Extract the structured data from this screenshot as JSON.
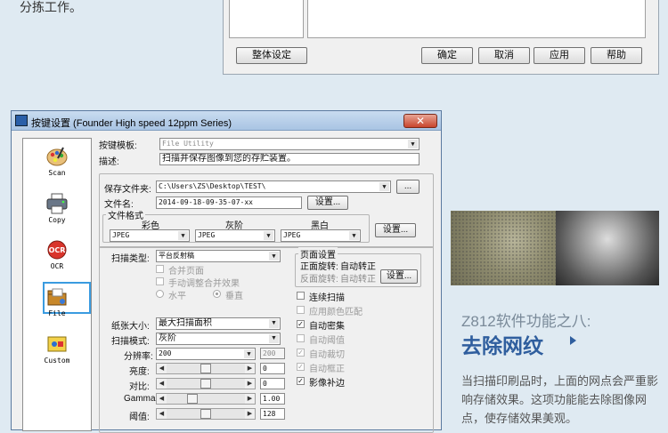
{
  "top_text": "分拣工作。",
  "prev_dialog": {
    "buttons": {
      "global": "整体设定",
      "ok": "确定",
      "cancel": "取消",
      "apply": "应用",
      "help": "帮助"
    }
  },
  "dialog": {
    "title": "按键设置 (Founder High speed 12ppm Series)",
    "close_label": "✕",
    "left_items": [
      {
        "label": "Scan",
        "icon": "paint-palette-icon"
      },
      {
        "label": "Copy",
        "icon": "printer-icon"
      },
      {
        "label": "OCR",
        "icon": "ocr-icon"
      },
      {
        "label": "File",
        "icon": "file-folder-icon"
      },
      {
        "label": "Custom",
        "icon": "custom-tools-icon"
      }
    ],
    "selected_item": "File",
    "template_label": "按键模板:",
    "template_value": "File Utility",
    "desc_label": "描述:",
    "desc_value": "扫描并保存图像到您的存贮装置。",
    "save_folder_label": "保存文件夹:",
    "save_folder_value": "C:\\Users\\ZS\\Desktop\\TEST\\",
    "browse_button": "...",
    "filename_label": "文件名:",
    "filename_value": "2014-09-18-09-35-07-xx",
    "filename_settings_button": "设置...",
    "file_format": {
      "title": "文件格式",
      "color_label": "彩色",
      "gray_label": "灰阶",
      "bw_label": "黑白",
      "color_value": "JPEG",
      "gray_value": "JPEG",
      "bw_value": "JPEG",
      "settings_button": "设置..."
    },
    "scan_type_label": "扫描类型:",
    "scan_type_value": "平台反射稿",
    "merge_pages_label": "合并页面",
    "manual_merge_label": "手动调整合并效果",
    "horizontal_label": "水平",
    "vertical_label": "垂直",
    "page_settings": {
      "title": "页面设置",
      "front_rotate_label": "正面旋转:",
      "front_rotate_value": "自动转正",
      "back_rotate_label": "反面旋转:",
      "back_rotate_value": "自动转正",
      "settings_button": "设置..."
    },
    "checks": [
      {
        "label": "连续扫描",
        "checked": false,
        "enabled": true
      },
      {
        "label": "应用颜色匹配",
        "checked": false,
        "enabled": false
      },
      {
        "label": "自动密集",
        "checked": true,
        "enabled": true
      },
      {
        "label": "自动阈值",
        "checked": false,
        "enabled": false
      },
      {
        "label": "自动裁切",
        "checked": true,
        "enabled": false
      },
      {
        "label": "自动框正",
        "checked": true,
        "enabled": false
      },
      {
        "label": "影像补边",
        "checked": true,
        "enabled": true
      }
    ],
    "paper_size_label": "纸张大小:",
    "paper_size_value": "最大扫描面积",
    "scan_mode_label": "扫描模式:",
    "scan_mode_value": "灰阶",
    "resolution_label": "分辨率:",
    "resolution_value": "200",
    "resolution_value2": "200",
    "brightness_label": "亮度:",
    "brightness_value": "0",
    "contrast_label": "对比:",
    "contrast_value": "0",
    "gamma_label": "Gamma:",
    "gamma_value": "1.00",
    "threshold_label": "阈值:",
    "threshold_value": "128",
    "sliders": {
      "brightness": 0.5,
      "contrast": 0.5,
      "gamma": 0.3,
      "threshold": 0.5
    }
  },
  "promo": {
    "subtitle": "Z812软件功能之八:",
    "title": "去除网纹",
    "description": "当扫描印刷品时，上面的网点会严重影响存储效果。这项功能能去除图像网点，使存储效果美观。"
  }
}
